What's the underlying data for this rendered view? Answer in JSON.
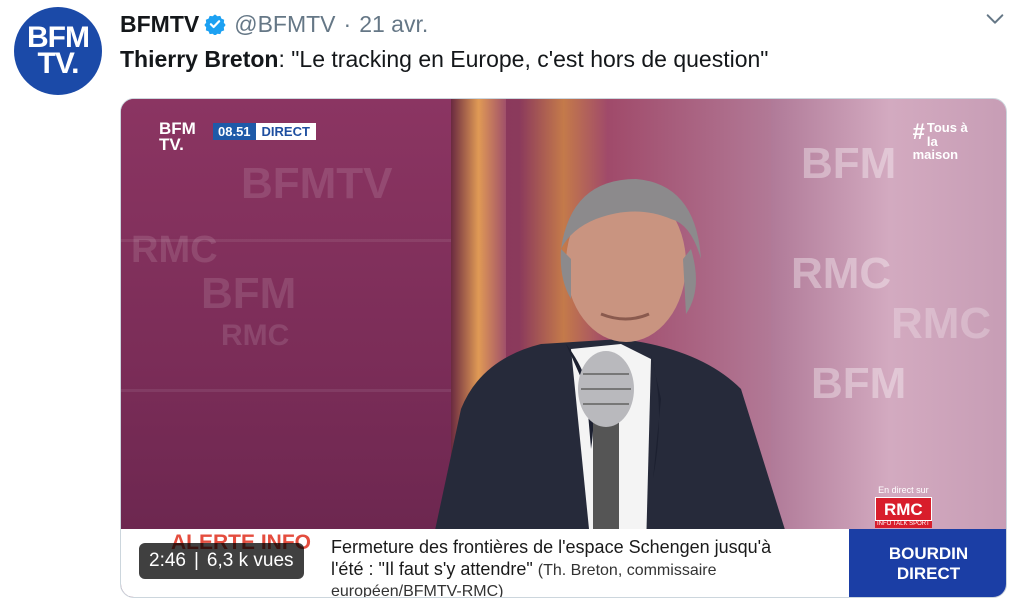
{
  "author": {
    "avatar_line1": "BFM",
    "avatar_line2": "TV.",
    "name": "BFMTV",
    "handle": "@BFMTV",
    "separator": "·",
    "date": "21 avr."
  },
  "tweet": {
    "speaker": "Thierry Breton",
    "quote": ": \"Le tracking en Europe, c'est hors de question\""
  },
  "video": {
    "channel_logo_line1": "BFM",
    "channel_logo_line2": "TV.",
    "broadcast_time": "08.51",
    "live_label": "DIRECT",
    "hashtag_line1": "Tous à la",
    "hashtag_line2": "maison",
    "hashtag_symbol": "#",
    "partner_caption": "En direct sur",
    "partner_logo": "RMC",
    "partner_tagline": "INFO TALK SPORT",
    "alert_label": "ALERTE INFO",
    "headline_line1": "Fermeture des frontières de l'espace Schengen jusqu'à",
    "headline_line2_prefix": "l'été : \"Il faut s'y attendre\"",
    "headline_source": "(Th. Breton, commissaire européen/BFMTV-RMC)",
    "show_line1": "BOURDIN",
    "show_line2": "DIRECT",
    "duration": "2:46",
    "views": "6,3 k vues"
  },
  "colors": {
    "brand_blue": "#1b4aa8",
    "verified_blue": "#1da1f2",
    "muted_text": "#657786",
    "alert_red": "#e23a2a"
  },
  "icons": {
    "verified": "verified-badge-icon",
    "menu": "chevron-down-icon"
  }
}
